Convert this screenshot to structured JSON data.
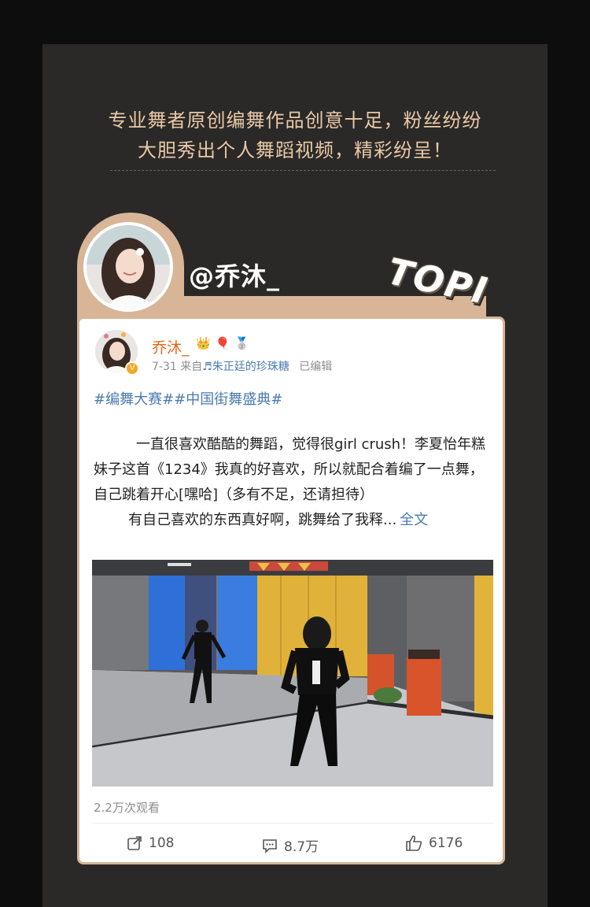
{
  "headline": {
    "line1": "专业舞者原创编舞作品创意十足，粉丝纷纷",
    "line2": "大胆秀出个人舞蹈视频，精彩纷呈！"
  },
  "profile": {
    "handle": "@乔沐_",
    "sticker": "TOPI",
    "avatar_icon": "avatar-photo"
  },
  "post": {
    "username": "乔沐_",
    "badges": [
      "👑",
      "🎈",
      "🥈"
    ],
    "verified": "V",
    "date": "7-31",
    "source_prefix": "来自",
    "source": "♬朱正廷的珍珠糖",
    "edited": "已编辑",
    "tags": "#编舞大赛##中国街舞盛典#",
    "paragraph1": "一直很喜欢酷酷的舞蹈，觉得很girl crush！李夏怡年糕妹子这首《1234》我真的好喜欢，所以就配合着编了一点舞，自己跳着开心[嘿哈]（多有不足，还请担待）",
    "paragraph2": "有自己喜欢的东西真好啊，跳舞给了我释...",
    "more_link": "全文",
    "views": "2.2万次观看",
    "actions": {
      "repost": "108",
      "comment": "8.7万",
      "like": "6176"
    }
  },
  "colors": {
    "accent_gold": "#d8b596",
    "headline_text": "#e9c9a7",
    "link_blue": "#4a7bb0",
    "username_orange": "#e0691a"
  }
}
